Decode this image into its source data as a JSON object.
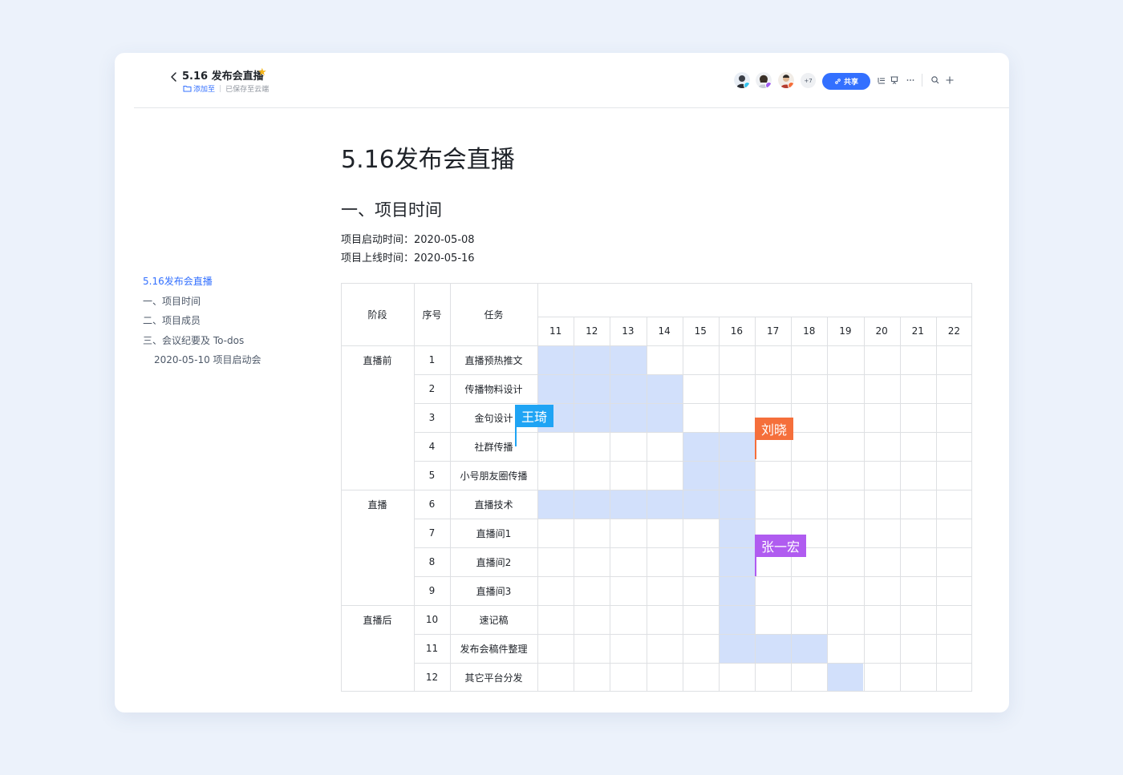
{
  "header": {
    "title": "5.16 发布会直播",
    "add_to_label": "添加至",
    "save_status": "已保存至云端",
    "more_users": "+7",
    "share_label": "共享"
  },
  "outline": {
    "items": [
      "5.16发布会直播",
      "一、项目时间",
      "二、项目成员",
      "三、会议纪要及 To-dos",
      "2020-05-10 项目启动会"
    ]
  },
  "content": {
    "title": "5.16发布会直播",
    "section_title": "一、项目时间",
    "start_line": "项目启动时间：2020-05-08",
    "launch_line": "项目上线时间：2020-05-16"
  },
  "gantt": {
    "headers": {
      "stage": "阶段",
      "index": "序号",
      "task": "任务"
    },
    "days": [
      "11",
      "12",
      "13",
      "14",
      "15",
      "16",
      "17",
      "18",
      "19",
      "20",
      "21",
      "22"
    ],
    "stages": [
      {
        "label": "直播前",
        "first_row": 0,
        "row_count": 5
      },
      {
        "label": "直播",
        "first_row": 5,
        "row_count": 4
      },
      {
        "label": "直播后",
        "first_row": 9,
        "row_count": 3
      }
    ],
    "rows": [
      {
        "index": "1",
        "task": "直播预热推文",
        "start_day": "11",
        "end_day": "13"
      },
      {
        "index": "2",
        "task": "传播物料设计",
        "start_day": "11",
        "end_day": "14"
      },
      {
        "index": "3",
        "task": "金句设计",
        "start_day": "11",
        "end_day": "14"
      },
      {
        "index": "4",
        "task": "社群传播",
        "start_day": "15",
        "end_day": "16"
      },
      {
        "index": "5",
        "task": "小号朋友圈传播",
        "start_day": "15",
        "end_day": "16"
      },
      {
        "index": "6",
        "task": "直播技术",
        "start_day": "11",
        "end_day": "16"
      },
      {
        "index": "7",
        "task": "直播间1",
        "start_day": "16",
        "end_day": "16"
      },
      {
        "index": "8",
        "task": "直播间2",
        "start_day": "16",
        "end_day": "16"
      },
      {
        "index": "9",
        "task": "直播间3",
        "start_day": "16",
        "end_day": "16"
      },
      {
        "index": "10",
        "task": "速记稿",
        "start_day": "16",
        "end_day": "16"
      },
      {
        "index": "11",
        "task": "发布会稿件整理",
        "start_day": "16",
        "end_day": "18"
      },
      {
        "index": "12",
        "task": "其它平台分发",
        "start_day": "19",
        "end_day": "19"
      }
    ],
    "cursors": [
      {
        "name": "王琦",
        "color": "#1fa4f4"
      },
      {
        "name": "刘晓",
        "color": "#f56f3b"
      },
      {
        "name": "张一宏",
        "color": "#b05cf0"
      }
    ]
  },
  "colors": {
    "accent": "#3370ff",
    "bar_fill": "#d2e0fb",
    "star": "#f5b51b"
  }
}
